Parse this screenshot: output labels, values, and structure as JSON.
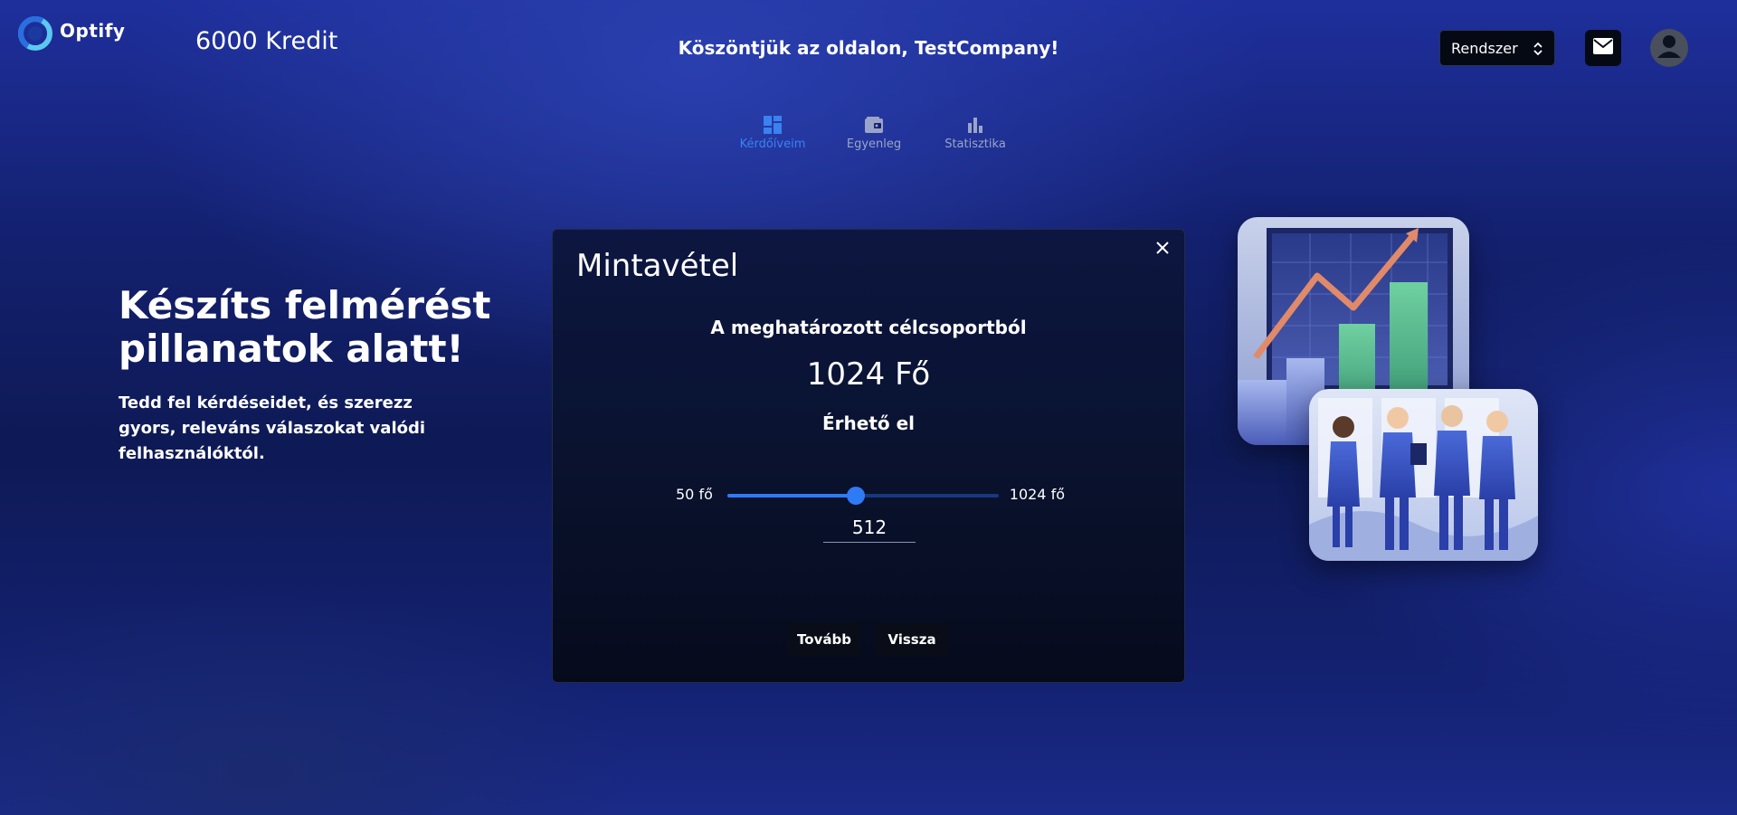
{
  "header": {
    "logo_text": "Optify",
    "credit": "6000 Kredit",
    "welcome": "Köszöntjük az oldalon, TestCompany!",
    "select_value": "Rendszer",
    "icons": [
      "logo-mark",
      "sort-icon",
      "mail-icon",
      "user-icon"
    ]
  },
  "nav": {
    "items": [
      {
        "label": "Kérdőíveim",
        "icon": "dashboard-icon",
        "active": true
      },
      {
        "label": "Egyenleg",
        "icon": "wallet-icon",
        "active": false
      },
      {
        "label": "Statisztika",
        "icon": "bar-chart-icon",
        "active": false
      }
    ]
  },
  "hero": {
    "title": "Készíts felmérést pillanatok alatt!",
    "subtitle": "Tedd fel kérdéseidet, és szerezz gyors, releváns válaszokat valódi felhasználóktól."
  },
  "modal": {
    "title": "Mintavétel",
    "subtitle": "A meghatározott célcsoportból",
    "count": "1024 Fő",
    "available": "Érhető el",
    "slider": {
      "min_label": "50 fő",
      "max_label": "1024 fő",
      "min": 50,
      "max": 1024,
      "value": 512
    },
    "input_value": "512",
    "next_label": "Tovább",
    "back_label": "Vissza"
  },
  "colors": {
    "accent": "#2f7af5",
    "nav_active": "#3a82f0",
    "button_bg": "#080d18"
  }
}
